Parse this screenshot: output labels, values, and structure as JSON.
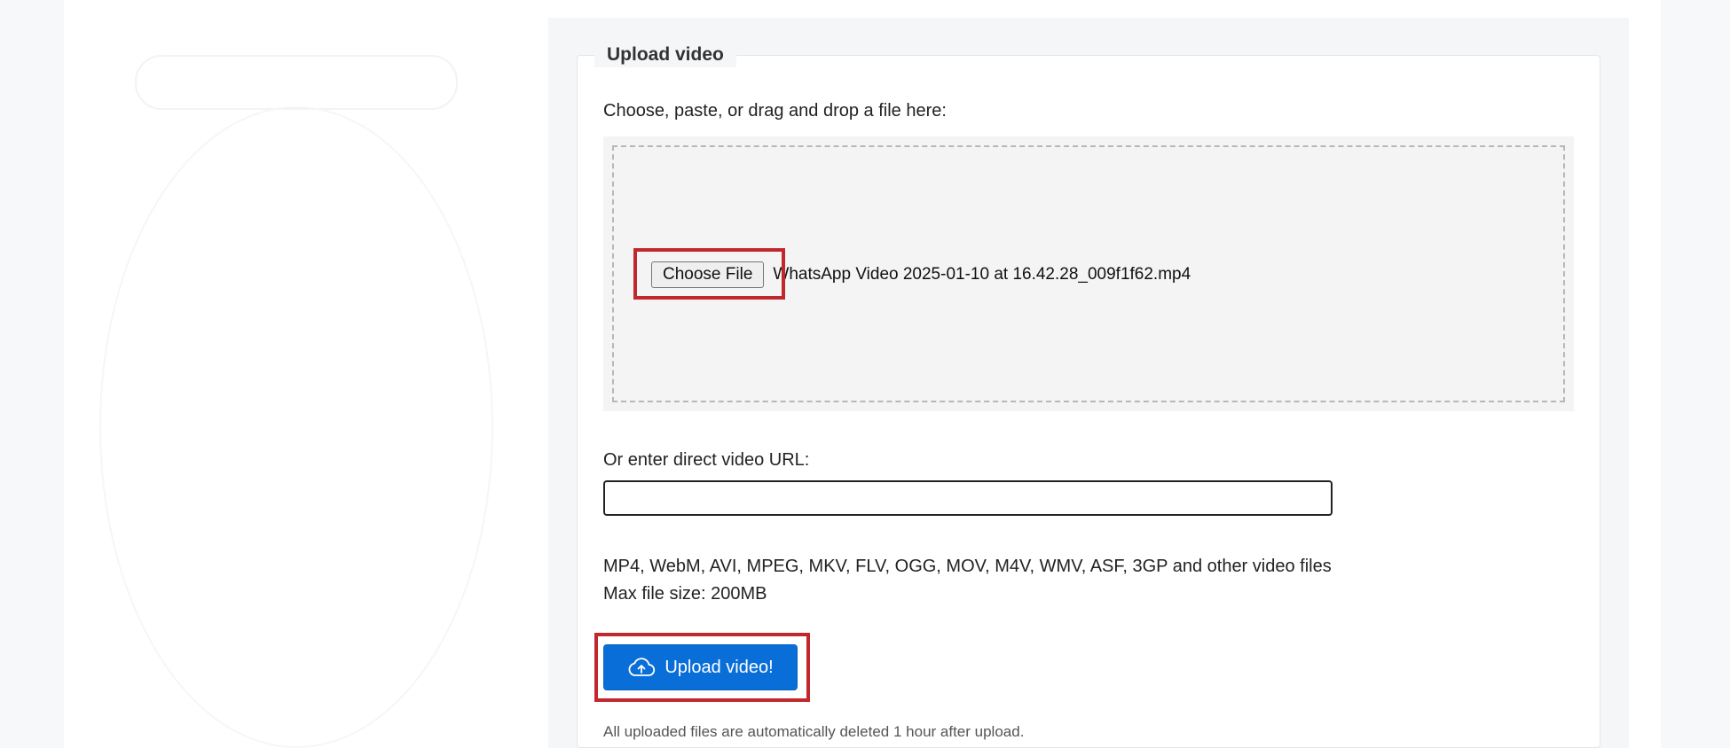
{
  "upload_form": {
    "legend": "Upload video",
    "dropzone_label": "Choose, paste, or drag and drop a file here:",
    "choose_file_button": "Choose File",
    "selected_file_name": "WhatsApp Video 2025-01-10 at 16.42.28_009f1f62.mp4",
    "url_label": "Or enter direct video URL:",
    "url_input_value": "",
    "formats_text": "MP4, WebM, AVI, MPEG, MKV, FLV, OGG, MOV, M4V, WMV, ASF, 3GP and other video files",
    "max_size_text": "Max file size: 200MB",
    "upload_button": "Upload video!",
    "footnote": "All uploaded files are automatically deleted 1 hour after upload."
  },
  "icons": {
    "upload_button_icon": "cloud-upload-icon"
  },
  "colors": {
    "primary_button": "#0a6ed8",
    "highlight_annotation": "#c2272d",
    "panel_background": "#f4f6f8",
    "dropzone_background": "#f4f4f5"
  }
}
